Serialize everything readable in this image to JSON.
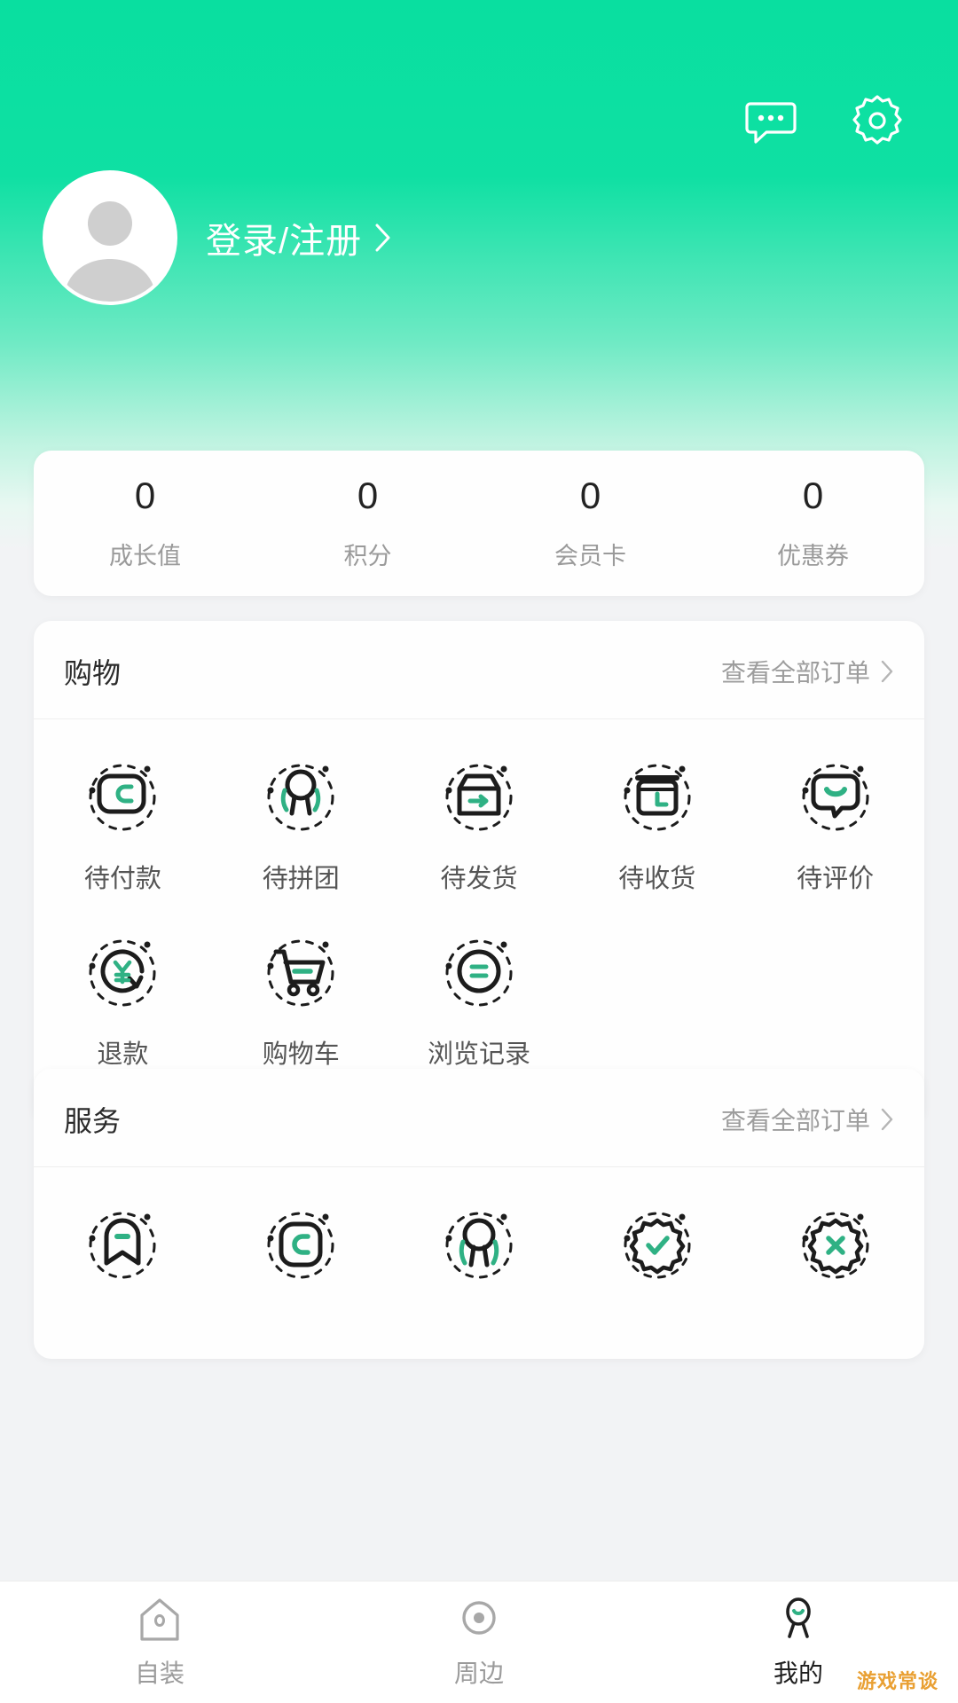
{
  "theme": {
    "brand_green": "#09dfa0",
    "accent_green": "#2fb184",
    "icon_dark": "#2b2b2b",
    "page_bg": "#f2f3f5"
  },
  "header": {
    "message_icon": "chat-bubble-icon",
    "settings_icon": "gear-icon",
    "avatar_icon": "default-avatar-icon",
    "login_label": "登录/注册",
    "login_chevron": "chevron-right-icon"
  },
  "stats": [
    {
      "value": "0",
      "label": "成长值"
    },
    {
      "value": "0",
      "label": "积分"
    },
    {
      "value": "0",
      "label": "会员卡"
    },
    {
      "value": "0",
      "label": "优惠券"
    }
  ],
  "shopping": {
    "title": "购物",
    "more_label": "查看全部订单",
    "more_chevron": "chevron-right-icon",
    "items": [
      {
        "label": "待付款",
        "icon": "wallet-card-icon"
      },
      {
        "label": "待拼团",
        "icon": "group-buy-icon"
      },
      {
        "label": "待发货",
        "icon": "box-arrow-icon"
      },
      {
        "label": "待收货",
        "icon": "box-clock-icon"
      },
      {
        "label": "待评价",
        "icon": "comment-smile-icon"
      },
      {
        "label": "退款",
        "icon": "refund-yuan-icon"
      },
      {
        "label": "购物车",
        "icon": "shopping-cart-icon"
      },
      {
        "label": "浏览记录",
        "icon": "history-circle-icon"
      }
    ]
  },
  "service": {
    "title": "服务",
    "more_label": "查看全部订单",
    "more_chevron": "chevron-right-icon",
    "items": [
      {
        "label": "",
        "icon": "bookmark-icon"
      },
      {
        "label": "",
        "icon": "card-icon"
      },
      {
        "label": "",
        "icon": "person-icon"
      },
      {
        "label": "",
        "icon": "badge-check-icon"
      },
      {
        "label": "",
        "icon": "badge-x-icon"
      }
    ]
  },
  "tabbar": {
    "items": [
      {
        "label": "自装",
        "icon": "house-icon",
        "active": false
      },
      {
        "label": "周边",
        "icon": "location-dot-icon",
        "active": false
      },
      {
        "label": "我的",
        "icon": "person-profile-icon",
        "active": true
      }
    ]
  },
  "watermark": {
    "text": "游戏常谈"
  }
}
